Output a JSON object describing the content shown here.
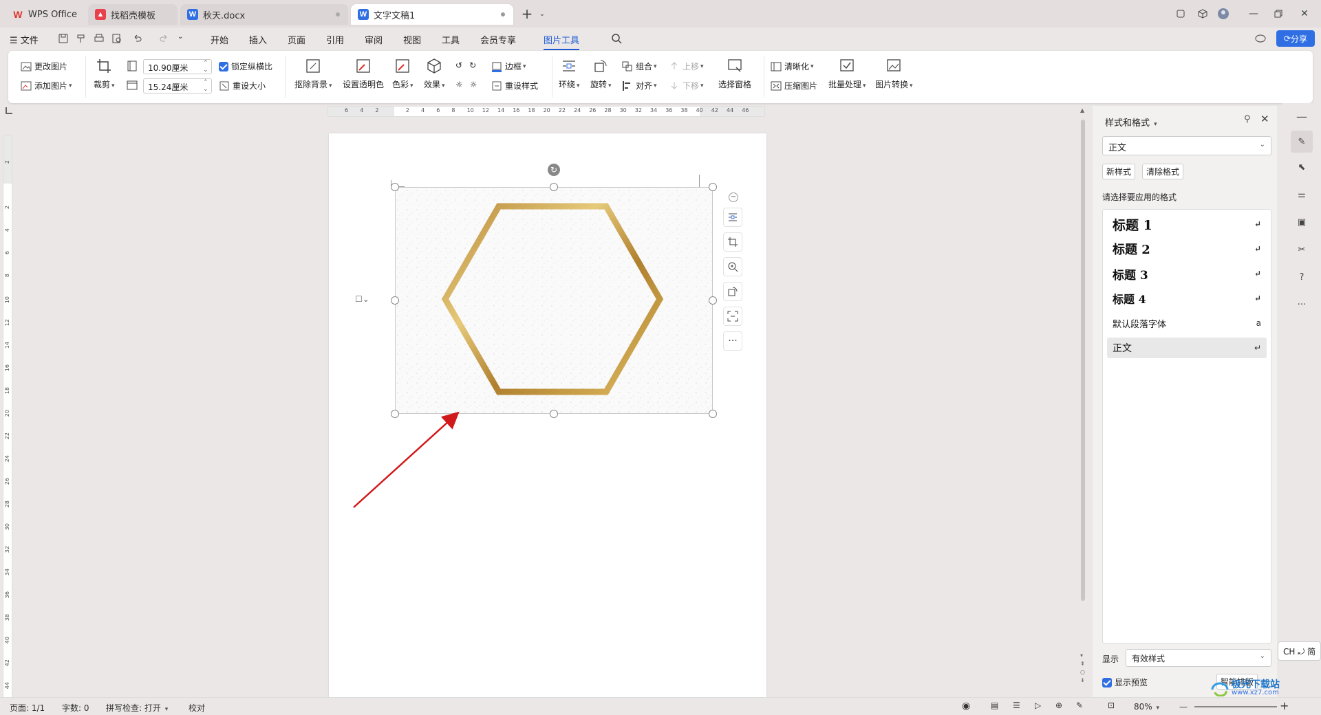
{
  "tabs": [
    {
      "label": "WPS Office",
      "icon": "wps-logo-icon",
      "color": "#e0312b"
    },
    {
      "label": "找稻壳模板",
      "icon": "docer-icon",
      "color": "#e8414c"
    },
    {
      "label": "秋天.docx",
      "icon": "word-doc-icon",
      "color": "#2f6fe3"
    },
    {
      "label": "文字文稿1",
      "icon": "word-doc-icon",
      "color": "#2f6fe3"
    }
  ],
  "menu": {
    "file": "文件",
    "items": [
      "开始",
      "插入",
      "页面",
      "引用",
      "审阅",
      "视图",
      "工具",
      "会员专享",
      "图片工具"
    ],
    "selected": "图片工具",
    "share": "分享"
  },
  "ribbon": {
    "change_pic": "更改图片",
    "add_pic": "添加图片",
    "crop": "裁剪",
    "width": "10.90厘米",
    "height": "15.24厘米",
    "lock_ratio": "锁定纵横比",
    "reset_size": "重设大小",
    "remove_bg": "抠除背景",
    "set_transparent": "设置透明色",
    "color": "色彩",
    "effects": "效果",
    "border": "边框",
    "reset_style": "重设样式",
    "wrap": "环绕",
    "rotate": "旋转",
    "group": "组合",
    "align": "对齐",
    "up": "上移",
    "down": "下移",
    "selection_pane": "选择窗格",
    "sharpen": "清晰化",
    "compress": "压缩图片",
    "batch": "批量处理",
    "convert": "图片转换"
  },
  "ruler": {
    "h_ticks": [
      "6",
      "4",
      "2",
      "",
      "2",
      "4",
      "6",
      "8",
      "10",
      "12",
      "14",
      "16",
      "18",
      "20",
      "22",
      "24",
      "26",
      "28",
      "30",
      "32",
      "34",
      "36",
      "38",
      "40",
      "42",
      "44",
      "46"
    ],
    "v_ticks": [
      "2",
      "",
      "2",
      "4",
      "6",
      "8",
      "10",
      "12",
      "14",
      "16",
      "18",
      "20",
      "22",
      "24",
      "26",
      "28",
      "30",
      "32",
      "34",
      "36",
      "38",
      "40",
      "42",
      "44"
    ]
  },
  "panel": {
    "title": "样式和格式",
    "current": "正文",
    "new_style": "新样式",
    "clear_format": "清除格式",
    "choose_label": "请选择要应用的格式",
    "styles": [
      {
        "label": "标题  1",
        "mark": "↵"
      },
      {
        "label": "标题  2",
        "mark": "↵"
      },
      {
        "label": "标题  3",
        "mark": "↵"
      },
      {
        "label": "标题  4",
        "mark": "↵"
      },
      {
        "label": "默认段落字体",
        "mark": "a"
      },
      {
        "label": "正文",
        "mark": "↵"
      }
    ],
    "show_label": "显示",
    "show_value": "有效样式",
    "preview_label": "显示预览",
    "smart_layout": "智能排版"
  },
  "status": {
    "page": "页面: 1/1",
    "words": "字数: 0",
    "spell": "拼写检查: 打开",
    "proof": "校对",
    "zoom": "80%"
  },
  "ime": "CH ⤾ 简",
  "watermark": "极光下载站",
  "watermark_url": "www.xz7.com",
  "colors": {
    "accent": "#2f6fe3",
    "hexagon_gold": "#c9a04a",
    "arrow": "#d0191b"
  }
}
